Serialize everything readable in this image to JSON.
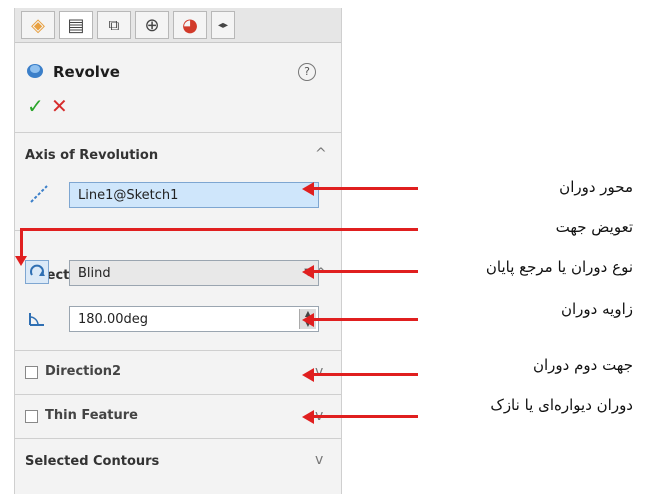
{
  "panel": {
    "tabs": [
      "feature-manager",
      "property-manager",
      "configuration-manager",
      "dimxpert-manager",
      "display-manager",
      "scroll-arrows"
    ],
    "title": "Revolve",
    "help_icon": "?",
    "ok_icon": "✓",
    "cancel_icon": "✕",
    "axis": {
      "heading": "Axis of Revolution",
      "value": "Line1@Sketch1"
    },
    "direction1": {
      "heading": "Direction1",
      "type_value": "Blind",
      "angle_value": "180.00deg"
    },
    "direction2": {
      "label": "Direction2"
    },
    "thin": {
      "label": "Thin Feature"
    },
    "contours": {
      "heading": "Selected Contours"
    },
    "collapse_up": "^",
    "collapse_down": "v"
  },
  "annotations": [
    "محور دوران",
    "تعویض جهت",
    "نوع دوران یا مرجع پایان",
    "زاویه دوران",
    "جهت دوم دوران",
    "دوران دیواره‌ای یا نازک"
  ],
  "colors": {
    "accent": "#e01f1f",
    "field_blue": "#cfe6fb",
    "ok": "#2aa52a",
    "cancel": "#d62c2c"
  }
}
